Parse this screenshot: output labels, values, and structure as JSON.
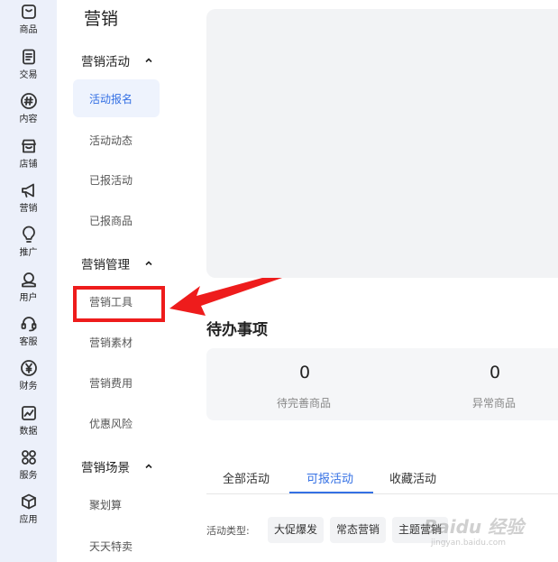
{
  "rail": {
    "items": [
      {
        "label": "商品",
        "icon": "product-icon"
      },
      {
        "label": "交易",
        "icon": "trade-icon"
      },
      {
        "label": "内容",
        "icon": "content-icon"
      },
      {
        "label": "店铺",
        "icon": "store-icon"
      },
      {
        "label": "营销",
        "icon": "megaphone-icon"
      },
      {
        "label": "推广",
        "icon": "bulb-icon"
      },
      {
        "label": "用户",
        "icon": "user-icon"
      },
      {
        "label": "客服",
        "icon": "headset-icon"
      },
      {
        "label": "财务",
        "icon": "yen-icon"
      },
      {
        "label": "数据",
        "icon": "chart-icon"
      },
      {
        "label": "服务",
        "icon": "apps-icon"
      },
      {
        "label": "应用",
        "icon": "cube-icon"
      }
    ]
  },
  "sidebar": {
    "title": "营销",
    "groups": [
      {
        "label": "营销活动",
        "items": [
          "活动报名",
          "活动动态",
          "已报活动",
          "已报商品"
        ]
      },
      {
        "label": "营销管理",
        "items": [
          "营销工具",
          "营销素材",
          "营销费用",
          "优惠风险"
        ]
      },
      {
        "label": "营销场景",
        "items": [
          "聚划算",
          "天天特卖"
        ]
      }
    ],
    "active_item": "活动报名",
    "highlighted_item": "营销工具"
  },
  "main": {
    "todo": {
      "title": "待办事项",
      "stats": [
        {
          "value": "0",
          "label": "待完善商品"
        },
        {
          "value": "0",
          "label": "异常商品"
        }
      ]
    },
    "tabs": [
      "全部活动",
      "可报活动",
      "收藏活动"
    ],
    "active_tab": "可报活动",
    "filter": {
      "label": "活动类型:",
      "chips": [
        "大促爆发",
        "常态营销",
        "主题营销"
      ]
    }
  },
  "watermark": {
    "text": "Baidu 经验",
    "sub": "jingyan.baidu.com"
  },
  "colors": {
    "accent": "#3470e4",
    "highlight": "#ee1c1c",
    "rail_bg": "#ecf0fa"
  }
}
